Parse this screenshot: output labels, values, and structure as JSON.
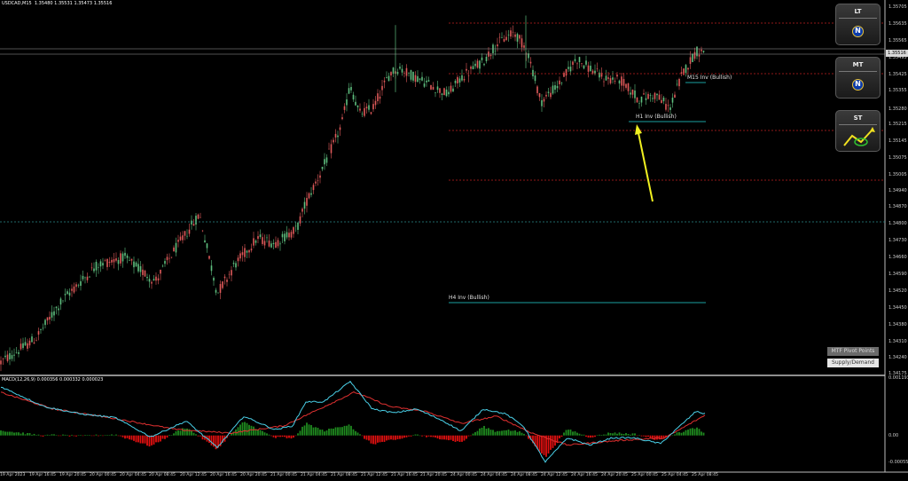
{
  "header": {
    "symbol": "USDCAD,M15",
    "ohlc": "1.35480 1.35531 1.35473 1.35516"
  },
  "price_axis": {
    "ticks": [
      "1.35705",
      "1.35635",
      "1.35565",
      "1.35495",
      "1.35425",
      "1.35355",
      "1.35280",
      "1.35215",
      "1.35145",
      "1.35075",
      "1.35005",
      "1.34940",
      "1.34870",
      "1.34800",
      "1.34730",
      "1.34660",
      "1.34590",
      "1.34520",
      "1.34450",
      "1.34380",
      "1.34310",
      "1.34240",
      "1.34175"
    ],
    "current_price": "1.35516"
  },
  "time_axis": {
    "ticks": [
      "19 Apr 2023",
      "19 Apr 16:45",
      "19 Apr 20:45",
      "20 Apr 00:45",
      "20 Apr 04:45",
      "20 Apr 08:45",
      "20 Apr 12:45",
      "20 Apr 16:45",
      "20 Apr 20:45",
      "21 Apr 00:45",
      "21 Apr 04:45",
      "21 Apr 08:45",
      "21 Apr 12:45",
      "21 Apr 16:45",
      "21 Apr 20:45",
      "24 Apr 00:45",
      "24 Apr 04:45",
      "24 Apr 08:45",
      "24 Apr 12:45",
      "24 Apr 16:45",
      "24 Apr 20:45",
      "25 Apr 00:45",
      "25 Apr 04:45",
      "25 Apr 08:45"
    ]
  },
  "macd": {
    "label": "MACD(12,26,9) 0.000356 0.000332 0.000023",
    "ticks": [
      "0.001193",
      "0.00",
      "-0.000559"
    ]
  },
  "panels": [
    {
      "title": "LT",
      "badge": "N"
    },
    {
      "title": "MT",
      "badge": "N"
    },
    {
      "title": "ST",
      "badge": ""
    }
  ],
  "buttons": {
    "mtf": "MTF Pivot Points",
    "sd": "Supply/Demand"
  },
  "zones": {
    "m15": "M15 Inv (Bullish)",
    "h1": "H1 Inv (Bullish)",
    "h4": "H4 Inv (Bullish)"
  },
  "colors": {
    "bull": "#5fbf7f",
    "bear": "#e05a5a",
    "macd_line": "#4ad0e8",
    "signal_line": "#e03030",
    "hist_pos": "#1f8a1f",
    "hist_neg": "#e01010",
    "zone_line": "#1aa0a0",
    "arrow": "#f0f020",
    "pivot_dotted": "#c02020"
  },
  "chart_data": {
    "type": "candlestick",
    "symbol": "USDCAD",
    "timeframe": "M15",
    "close_path": [
      [
        0,
        1.3422
      ],
      [
        40,
        1.3432
      ],
      [
        70,
        1.3448
      ],
      [
        110,
        1.3463
      ],
      [
        140,
        1.3466
      ],
      [
        175,
        1.3456
      ],
      [
        195,
        1.3468
      ],
      [
        225,
        1.3484
      ],
      [
        245,
        1.3451
      ],
      [
        265,
        1.3463
      ],
      [
        290,
        1.3474
      ],
      [
        310,
        1.3472
      ],
      [
        335,
        1.3478
      ],
      [
        345,
        1.3489
      ],
      [
        365,
        1.3504
      ],
      [
        385,
        1.3521
      ],
      [
        395,
        1.3538
      ],
      [
        405,
        1.3526
      ],
      [
        420,
        1.3528
      ],
      [
        440,
        1.3543
      ],
      [
        450,
        1.3545
      ],
      [
        470,
        1.3541
      ],
      [
        505,
        1.3534
      ],
      [
        520,
        1.3541
      ],
      [
        545,
        1.3548
      ],
      [
        560,
        1.3555
      ],
      [
        580,
        1.356
      ],
      [
        595,
        1.3552
      ],
      [
        610,
        1.3531
      ],
      [
        630,
        1.3538
      ],
      [
        650,
        1.3549
      ],
      [
        680,
        1.3541
      ],
      [
        700,
        1.354
      ],
      [
        720,
        1.3532
      ],
      [
        740,
        1.3534
      ],
      [
        755,
        1.3528
      ],
      [
        770,
        1.3543
      ],
      [
        785,
        1.3552
      ],
      [
        795,
        1.3552
      ]
    ],
    "macd_path": [
      [
        0,
        0.00102
      ],
      [
        50,
        0.0006
      ],
      [
        90,
        0.00045
      ],
      [
        130,
        0.00037
      ],
      [
        170,
        -3e-05
      ],
      [
        210,
        0.0003
      ],
      [
        245,
        -0.00025
      ],
      [
        275,
        0.0004
      ],
      [
        310,
        0.00012
      ],
      [
        330,
        0.0002
      ],
      [
        345,
        0.0007
      ],
      [
        365,
        0.0007
      ],
      [
        395,
        0.00112
      ],
      [
        420,
        0.00055
      ],
      [
        445,
        0.00047
      ],
      [
        470,
        0.00055
      ],
      [
        500,
        0.0003
      ],
      [
        520,
        9e-05
      ],
      [
        545,
        0.00055
      ],
      [
        570,
        0.00045
      ],
      [
        590,
        0.0002
      ],
      [
        615,
        -0.00055
      ],
      [
        640,
        -5e-05
      ],
      [
        665,
        -0.0002
      ],
      [
        690,
        -5e-05
      ],
      [
        715,
        -5e-05
      ],
      [
        745,
        -0.00017
      ],
      [
        770,
        0.00025
      ],
      [
        785,
        0.0005
      ],
      [
        795,
        0.00045
      ]
    ],
    "signal_path": [
      [
        0,
        0.0009
      ],
      [
        60,
        0.00055
      ],
      [
        130,
        0.00035
      ],
      [
        200,
        0.00012
      ],
      [
        260,
        5e-05
      ],
      [
        320,
        0.0002
      ],
      [
        360,
        0.00055
      ],
      [
        400,
        0.0009
      ],
      [
        440,
        0.0006
      ],
      [
        480,
        0.0005
      ],
      [
        520,
        0.00025
      ],
      [
        560,
        0.0004
      ],
      [
        600,
        5e-05
      ],
      [
        640,
        -0.0002
      ],
      [
        700,
        -0.0001
      ],
      [
        750,
        -5e-05
      ],
      [
        795,
        0.00042
      ]
    ]
  }
}
